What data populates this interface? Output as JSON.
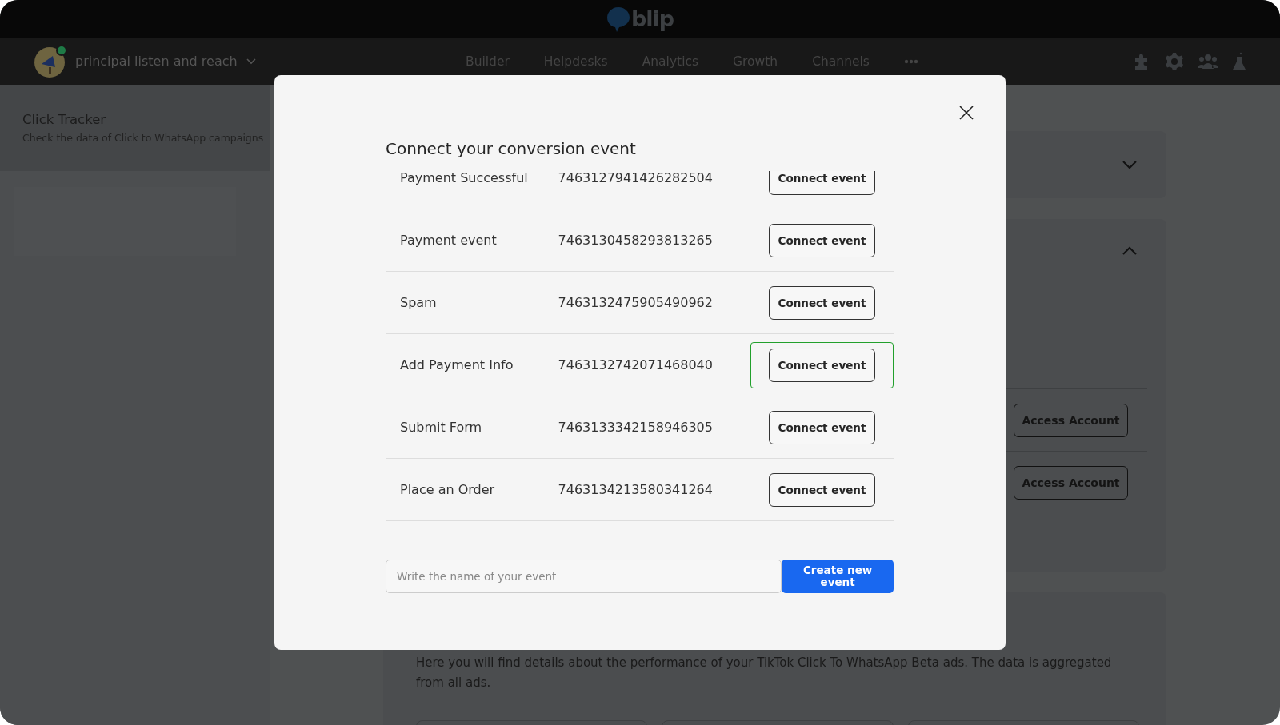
{
  "app": {
    "logo": "blip"
  },
  "nav": {
    "account": "principal listen and reach",
    "tabs": [
      "Builder",
      "Helpdesks",
      "Analytics",
      "Growth",
      "Channels"
    ]
  },
  "page": {
    "title": "Click Tracker",
    "subtitle": "Check the data of Click to WhatsApp campaigns",
    "accounts": [
      {
        "button": "Access Account"
      },
      {
        "button": "Access Account"
      }
    ],
    "description": "Here you will find details about the performance of your TikTok Click To WhatsApp Beta ads. The data is aggregated from all ads."
  },
  "dialog": {
    "title": "Connect your conversion event",
    "events": [
      {
        "name": "Payment Successful",
        "id": "7463127941426282504",
        "button": "Connect event",
        "focused": false
      },
      {
        "name": "Payment event",
        "id": "7463130458293813265",
        "button": "Connect event",
        "focused": false
      },
      {
        "name": "Spam",
        "id": "7463132475905490962",
        "button": "Connect event",
        "focused": false
      },
      {
        "name": "Add Payment Info",
        "id": "7463132742071468040",
        "button": "Connect event",
        "focused": true
      },
      {
        "name": "Submit Form",
        "id": "7463133342158946305",
        "button": "Connect event",
        "focused": false
      },
      {
        "name": "Place an Order",
        "id": "7463134213580341264",
        "button": "Connect event",
        "focused": false
      }
    ],
    "input": {
      "placeholder": "Write the name of your event"
    },
    "create_button": "Create new event"
  }
}
